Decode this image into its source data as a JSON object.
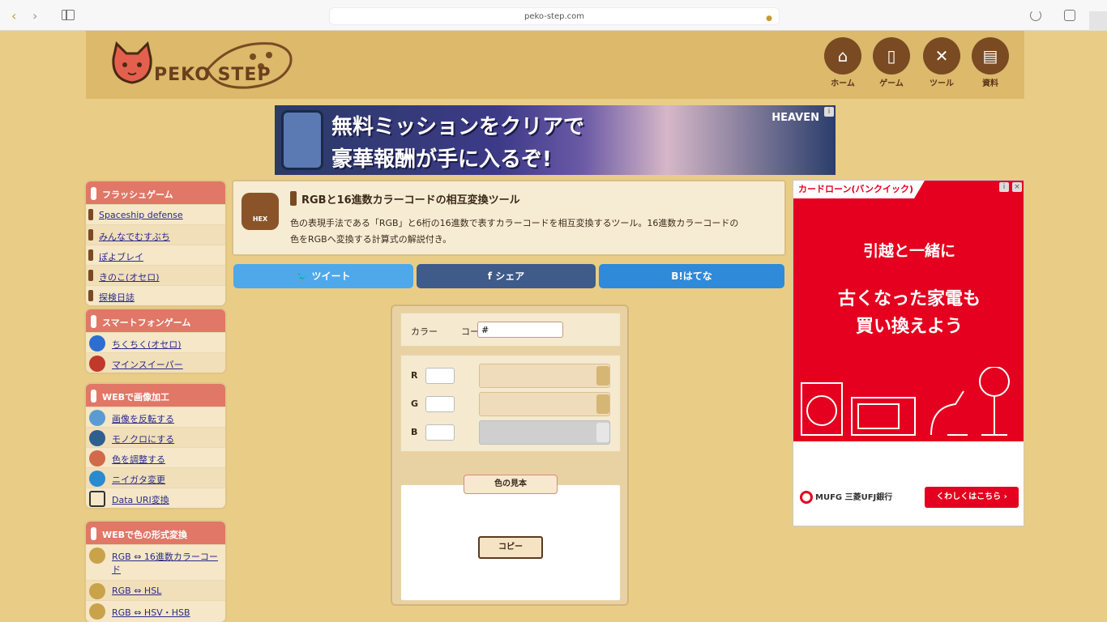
{
  "browser": {
    "address": "peko-step.com",
    "back_label": "‹",
    "forward_label": "›"
  },
  "header": {
    "logo_text": "PEKO STEP",
    "nav": [
      {
        "label": "ホーム",
        "icon": "home-icon"
      },
      {
        "label": "ゲーム",
        "icon": "phone-icon"
      },
      {
        "label": "ツール",
        "icon": "tools-icon"
      },
      {
        "label": "資料",
        "icon": "document-icon"
      }
    ]
  },
  "banner": {
    "line1": "無料ミッションをクリアで",
    "line2": "豪華報酬が手に入るぞ!",
    "game_logo": "HEAVEN"
  },
  "sidebar": {
    "sections": [
      {
        "title": "フラッシュゲーム",
        "items": [
          "Spaceship defense",
          "みんなでむすぶち",
          "ぽよブレイ",
          "きのこ(オセロ)",
          "探検日誌"
        ]
      },
      {
        "title": "スマートフォンゲーム",
        "items": [
          "ちくちく(オセロ)",
          "マインスイーパー"
        ]
      },
      {
        "title": "WEBで画像加工",
        "items": [
          "画像を反転する",
          "モノクロにする",
          "色を調整する",
          "ニイガタ変更",
          "Data URI変換"
        ]
      },
      {
        "title": "WEBで色の形式変換",
        "items": [
          "RGB ⇔ 16進数カラーコード",
          "RGB ⇔ HSL",
          "RGB ⇔ HSV・HSB"
        ]
      }
    ]
  },
  "tool": {
    "title": "RGBと16進数カラーコードの相互変換ツール",
    "icon_label": "HEX",
    "description": "色の表現手法である「RGB」と6桁の16進数で表すカラーコードを相互変換するツール。16進数カラーコードの色をRGBへ変換する計算式の解説付き。",
    "share": {
      "twitter": "ツイート",
      "facebook": "シェア",
      "hatena": "B!はてな"
    },
    "count_label": "カラー",
    "code_label": "コード",
    "code_value": "#",
    "rgb": [
      {
        "channel": "R",
        "value": ""
      },
      {
        "channel": "G",
        "value": ""
      },
      {
        "channel": "B",
        "value": ""
      }
    ],
    "result_label": "色の見本",
    "copy_label": "コピー"
  },
  "right_ad": {
    "tag": "カードローン(バンクイック)",
    "line1": "引越と一緒に",
    "line2": "古くなった家電も",
    "line3": "買い換えよう",
    "bank": "MUFG 三菱UFJ銀行",
    "cta": "くわしくはこちら ›"
  },
  "colors": {
    "page_bg": "#e9cd86",
    "header_bg": "#dcb96b",
    "accent_brown": "#7a4a23",
    "sidebar_head": "#e07767",
    "twitter": "#4fa8ea",
    "facebook": "#3e5b8a",
    "hatena": "#2f8ad9",
    "ad_red": "#e4001e"
  }
}
